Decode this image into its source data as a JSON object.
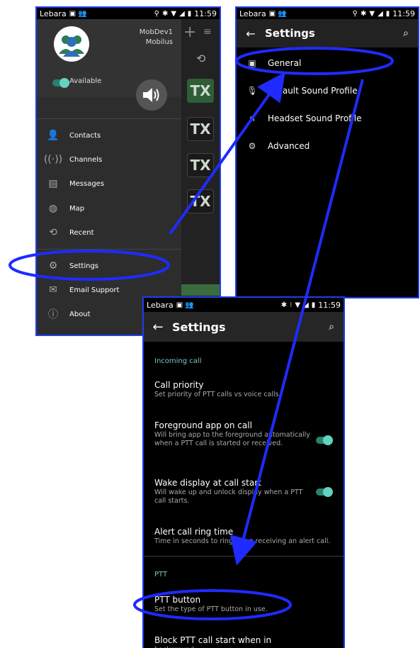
{
  "status": {
    "carrier": "Lebara",
    "time": "11:59"
  },
  "phone1": {
    "user_line1": "MobDev1",
    "user_line2": "Mobilus",
    "availability": "Available",
    "tx_labels": [
      "TX",
      "TX",
      "TX",
      "TX"
    ],
    "menu": [
      {
        "label": "Contacts",
        "icon": "person-icon"
      },
      {
        "label": "Channels",
        "icon": "antenna-icon"
      },
      {
        "label": "Messages",
        "icon": "message-icon"
      },
      {
        "label": "Map",
        "icon": "globe-icon"
      },
      {
        "label": "Recent",
        "icon": "history-icon"
      },
      {
        "label": "Settings",
        "icon": "gear-icon"
      },
      {
        "label": "Email Support",
        "icon": "mail-icon"
      },
      {
        "label": "About",
        "icon": "info-icon"
      }
    ]
  },
  "phone2": {
    "title": "Settings",
    "items": [
      {
        "label": "General",
        "icon": "settings-phone-icon"
      },
      {
        "label": "Default Sound Profile",
        "icon": "microphone-icon"
      },
      {
        "label": "Headset Sound Profile",
        "icon": "headset-icon"
      },
      {
        "label": "Advanced",
        "icon": "gears-icon"
      }
    ]
  },
  "phone3": {
    "title": "Settings",
    "section1": "Incoming call",
    "prefs": [
      {
        "title": "Call priority",
        "summary": "Set priority of PTT calls vs voice calls."
      },
      {
        "title": "Foreground app on call",
        "summary": "Will bring app to the foreground automatically when a PTT call is started or received."
      },
      {
        "title": "Wake display at call start",
        "summary": "Will wake up and unlock display when a PTT call starts."
      },
      {
        "title": "Alert call ring time",
        "summary": "Time in seconds to ring when receiving an alert call."
      }
    ],
    "section2": "PTT",
    "ptt_prefs": [
      {
        "title": "PTT button",
        "summary": "Set the type of PTT button in use."
      },
      {
        "title": "Block PTT call start when in",
        "summary": "background"
      }
    ]
  },
  "colors": {
    "annotation": "#1f2bff",
    "accent": "#63d3c1",
    "section": "#7ec4c4"
  }
}
